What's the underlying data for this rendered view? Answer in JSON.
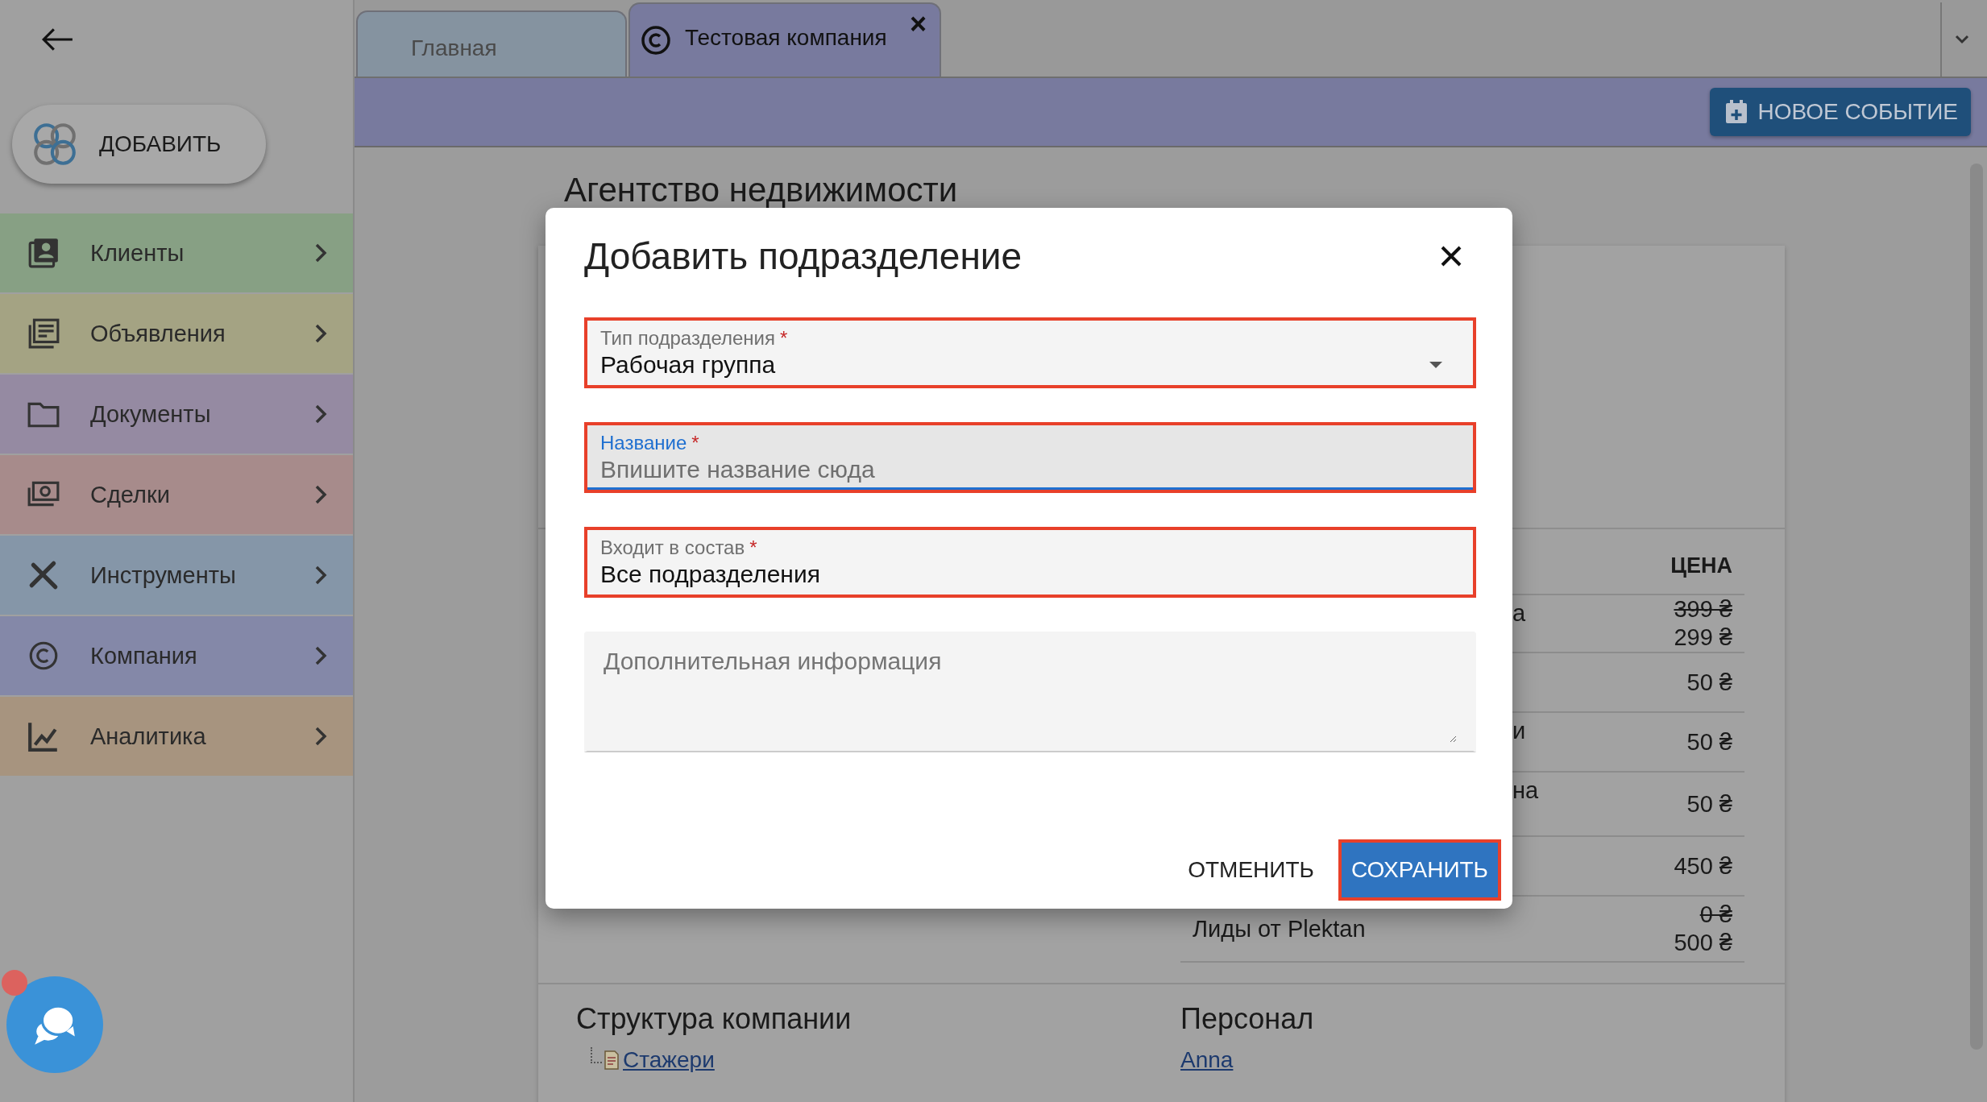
{
  "add_button": {
    "label": "ДОБАВИТЬ"
  },
  "sidebar": {
    "items": [
      {
        "label": "Клиенты",
        "color": "#87a084",
        "selected": false
      },
      {
        "label": "Объявления",
        "color": "#a4a383",
        "selected": false
      },
      {
        "label": "Документы",
        "color": "#958aa2",
        "selected": false
      },
      {
        "label": "Сделки",
        "color": "#a78b8b",
        "selected": false
      },
      {
        "label": "Инструменты",
        "color": "#8596a8",
        "selected": false
      },
      {
        "label": "Компания",
        "color": "#8488a8",
        "selected": false
      },
      {
        "label": "Аналитика",
        "color": "#a7947f",
        "selected": false
      }
    ]
  },
  "tabs": [
    {
      "label": "Главная",
      "selected": false
    },
    {
      "label": "Тестовая компания",
      "selected": true,
      "close_label": "×"
    }
  ],
  "toolbar": {
    "new_event_button": "НОВОЕ СОБЫТИЕ"
  },
  "page": {
    "title": "Агентство недвижимости",
    "price_table": {
      "header": "ЦЕНА",
      "rows": [
        {
          "name": "а",
          "partial": true,
          "old_price": "399 ₴",
          "price": "299 ₴"
        },
        {
          "price": "50 ₴"
        },
        {
          "name": "и",
          "partial": true,
          "price": "50 ₴"
        },
        {
          "name": "на",
          "partial": true,
          "price": "50 ₴"
        },
        {
          "price": "450 ₴"
        },
        {
          "name": "Лиды от Plektan",
          "partial": false,
          "old_price": "0 ₴",
          "price": "500 ₴"
        }
      ]
    },
    "structure": {
      "title": "Структура компании",
      "items": [
        {
          "label": "Стажери"
        }
      ]
    },
    "staff": {
      "title": "Персонал",
      "people": [
        {
          "name": "Anna"
        }
      ]
    }
  },
  "dialog": {
    "title": "Добавить подразделение",
    "fields": [
      {
        "kind": "select",
        "label": "Тип подразделения",
        "required_mark": "*",
        "value": "Рабочая группа",
        "focused": false,
        "highlighted": true
      },
      {
        "kind": "text",
        "label": "Название",
        "required_mark": "*",
        "placeholder": "Впишите название сюда",
        "focused": true,
        "highlighted": true
      },
      {
        "kind": "text",
        "label": "Входит в состав",
        "required_mark": "*",
        "value": "Все подразделения",
        "focused": false,
        "highlighted": true
      },
      {
        "kind": "textarea",
        "placeholder": "Дополнительная информация",
        "focused": false,
        "highlighted": false
      }
    ],
    "buttons": [
      {
        "label": "ОТМЕНИТЬ",
        "kind": "text",
        "highlighted": false
      },
      {
        "label": "СОХРАНИТЬ",
        "kind": "primary",
        "highlighted": true
      }
    ]
  }
}
